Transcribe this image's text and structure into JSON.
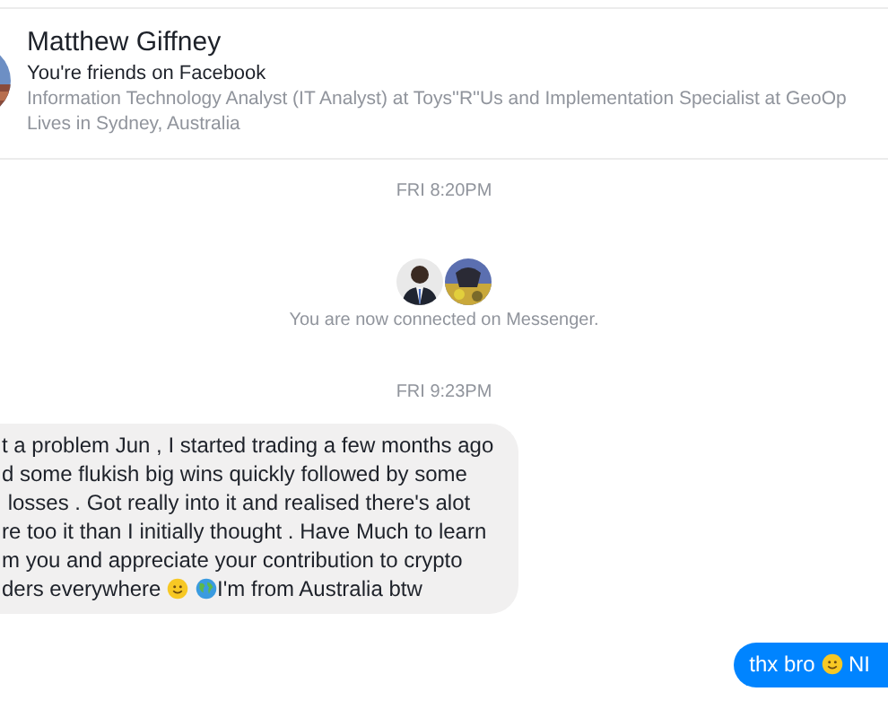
{
  "profile": {
    "name": "Matthew Giffney",
    "relation": "You're friends on Facebook",
    "work": "Information Technology Analyst (IT Analyst) at Toys''R''Us and Implementation Specialist at GeoOp",
    "location": "Lives in Sydney, Australia"
  },
  "timeline": [
    {
      "kind": "timestamp",
      "text": "FRI 8:20PM"
    },
    {
      "kind": "connected",
      "text": "You are now connected on Messenger."
    },
    {
      "kind": "timestamp",
      "text": "FRI 9:23PM"
    },
    {
      "kind": "received",
      "lines": [
        [
          {
            "kind": "text",
            "text": "t a problem Jun , I started trading a few months ago"
          }
        ],
        [
          {
            "kind": "text",
            "text": "d some flukish big wins quickly followed by some"
          }
        ],
        [
          {
            "kind": "text",
            "text": " losses . Got really into it and realised there's alot"
          }
        ],
        [
          {
            "kind": "text",
            "text": "re too it than I initially thought . Have Much to learn"
          }
        ],
        [
          {
            "kind": "text",
            "text": "m you and appreciate your contribution to crypto"
          }
        ],
        [
          {
            "kind": "text",
            "text": "ders everywhere "
          },
          {
            "kind": "smiley"
          },
          {
            "kind": "globe"
          },
          {
            "kind": "text",
            "text": "I'm from Australia btw"
          }
        ]
      ]
    },
    {
      "kind": "sent",
      "lines": [
        [
          {
            "kind": "text",
            "text": "thx bro "
          },
          {
            "kind": "smiley"
          },
          {
            "kind": "text",
            "text": " NI"
          }
        ]
      ]
    }
  ]
}
